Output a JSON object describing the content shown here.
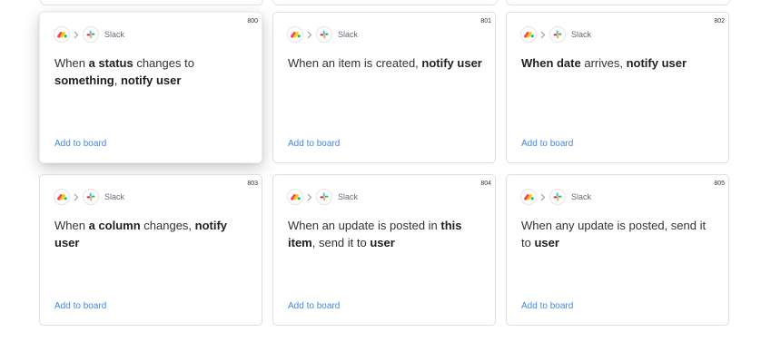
{
  "colors": {
    "accent_link": "#3f8ae0",
    "text": "#323338",
    "muted": "#676879"
  },
  "cards": [
    {
      "number": "800",
      "app_name": "Slack",
      "source_icon": "monday-logo-icon",
      "target_icon": "slack-logo-icon",
      "parts": [
        "When ",
        "a status",
        " changes to ",
        "something",
        ", ",
        "notify user"
      ],
      "action_label": "Add to board"
    },
    {
      "number": "801",
      "app_name": "Slack",
      "source_icon": "monday-logo-icon",
      "target_icon": "slack-logo-icon",
      "parts": [
        "When an item is created, ",
        "notify user"
      ],
      "action_label": "Add to board"
    },
    {
      "number": "802",
      "app_name": "Slack",
      "source_icon": "monday-logo-icon",
      "target_icon": "slack-logo-icon",
      "parts": [
        "When date",
        " arrives, ",
        "notify user"
      ],
      "action_label": "Add to board"
    },
    {
      "number": "803",
      "app_name": "Slack",
      "source_icon": "monday-logo-icon",
      "target_icon": "slack-logo-icon",
      "parts": [
        "When ",
        "a column",
        " changes, ",
        "notify user"
      ],
      "action_label": "Add to board"
    },
    {
      "number": "804",
      "app_name": "Slack",
      "source_icon": "monday-logo-icon",
      "target_icon": "slack-logo-icon",
      "parts": [
        "When an update is posted in ",
        "this item",
        ", send it to ",
        "user"
      ],
      "action_label": "Add to board"
    },
    {
      "number": "805",
      "app_name": "Slack",
      "source_icon": "monday-logo-icon",
      "target_icon": "slack-logo-icon",
      "parts": [
        "When any update is posted, send it to ",
        "user"
      ],
      "action_label": "Add to board"
    }
  ]
}
